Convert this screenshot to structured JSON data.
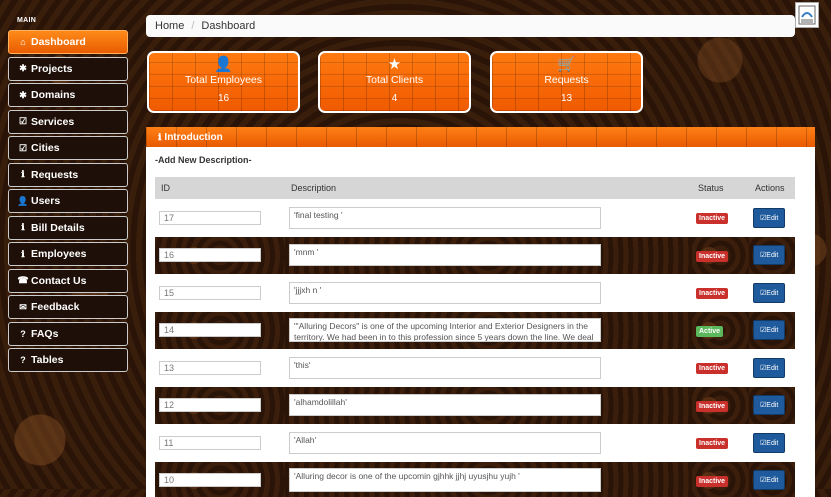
{
  "sidebar": {
    "section_label": "MAIN",
    "items": [
      {
        "label": "Dashboard",
        "icon": "home-icon",
        "glyph": "⌂"
      },
      {
        "label": "Projects",
        "icon": "asterisk-icon",
        "glyph": "✱"
      },
      {
        "label": "Domains",
        "icon": "asterisk-icon",
        "glyph": "✱"
      },
      {
        "label": "Services",
        "icon": "check-square-icon",
        "glyph": "☑"
      },
      {
        "label": "Cities",
        "icon": "check-square-icon",
        "glyph": "☑"
      },
      {
        "label": "Requests",
        "icon": "info-icon",
        "glyph": "ℹ"
      },
      {
        "label": "Users",
        "icon": "user-icon",
        "glyph": "👤"
      },
      {
        "label": "Bill Details",
        "icon": "info-icon",
        "glyph": "ℹ"
      },
      {
        "label": "Employees",
        "icon": "info-icon",
        "glyph": "ℹ"
      },
      {
        "label": "Contact Us",
        "icon": "phone-icon",
        "glyph": "☎"
      },
      {
        "label": "Feedback",
        "icon": "envelope-icon",
        "glyph": "✉"
      },
      {
        "label": "FAQs",
        "icon": "question-icon",
        "glyph": "?"
      },
      {
        "label": "Tables",
        "icon": "question-icon",
        "glyph": "?"
      }
    ]
  },
  "breadcrumb": {
    "home": "Home",
    "current": "Dashboard"
  },
  "stats": [
    {
      "label": "Total Employees",
      "value": "16",
      "icon": "user-icon",
      "glyph": "👤"
    },
    {
      "label": "Total Clients",
      "value": "4",
      "icon": "star-icon",
      "glyph": "★"
    },
    {
      "label": "Requests",
      "value": "13",
      "icon": "cart-icon",
      "glyph": "🛒"
    }
  ],
  "panel": {
    "title": "Introduction",
    "subtitle": "-Add New Description-",
    "columns": {
      "id": "ID",
      "description": "Description",
      "status": "Status",
      "actions": "Actions"
    },
    "edit_label": "Edit",
    "rows": [
      {
        "id": "17",
        "description": "'final testing '",
        "status": "Inactive"
      },
      {
        "id": "16",
        "description": "'mnm '",
        "status": "Inactive"
      },
      {
        "id": "15",
        "description": "'jjjxh n '",
        "status": "Inactive"
      },
      {
        "id": "14",
        "description": "\"'Alluring Decors\" is one of the upcoming Interior and Exterior Designers in the territory. We had been in to this profession since 5 years down the line. We deal",
        "status": "Active"
      },
      {
        "id": "13",
        "description": "'this'",
        "status": "Inactive"
      },
      {
        "id": "12",
        "description": "'alhamdolillah'",
        "status": "Inactive"
      },
      {
        "id": "11",
        "description": "'Allah'",
        "status": "Inactive"
      },
      {
        "id": "10",
        "description": "'Alluring decor is one of the upcomin gjhhk jjhj uyusjhu yujh '",
        "status": "Inactive"
      }
    ]
  },
  "colors": {
    "accent": "#f26a00",
    "inactive": "#c9302c",
    "active": "#5cb85c",
    "edit": "#1e5a9c"
  }
}
